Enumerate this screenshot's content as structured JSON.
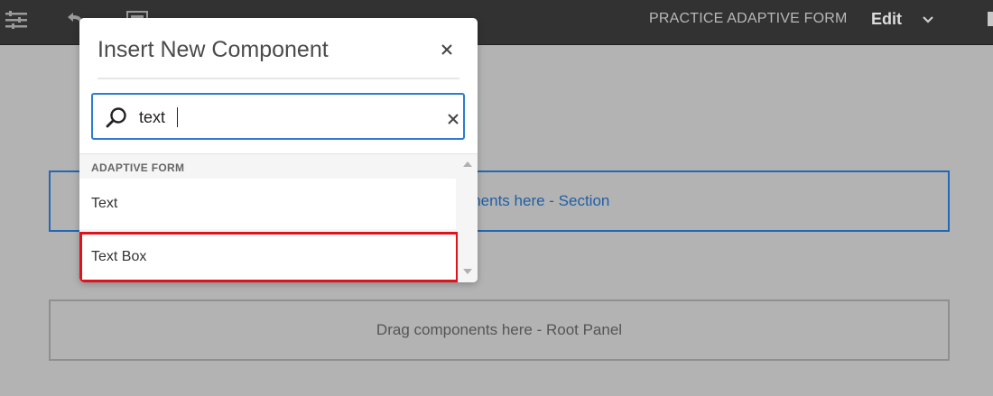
{
  "header": {
    "form_title": "PRACTICE ADAPTIVE FORM",
    "mode": "Edit",
    "icons": [
      "properties-icon",
      "undo-icon",
      "preview-icon",
      "chevron-down-icon"
    ]
  },
  "canvas": {
    "section_panel_text": "Drag components here - Section",
    "root_panel_text": "Drag components here - Root Panel"
  },
  "dialog": {
    "title": "Insert New Component",
    "close_icon": "close-icon",
    "search": {
      "value": "text",
      "icon": "search-icon",
      "clear_icon": "clear-icon"
    },
    "group_label": "ADAPTIVE FORM",
    "items": [
      {
        "label": "Text"
      },
      {
        "label": "Text Box",
        "highlighted": true
      }
    ]
  },
  "colors": {
    "topbar": "#323232",
    "accent": "#2d7ccf",
    "highlight": "#e0121b",
    "section_border": "#2168b5"
  }
}
